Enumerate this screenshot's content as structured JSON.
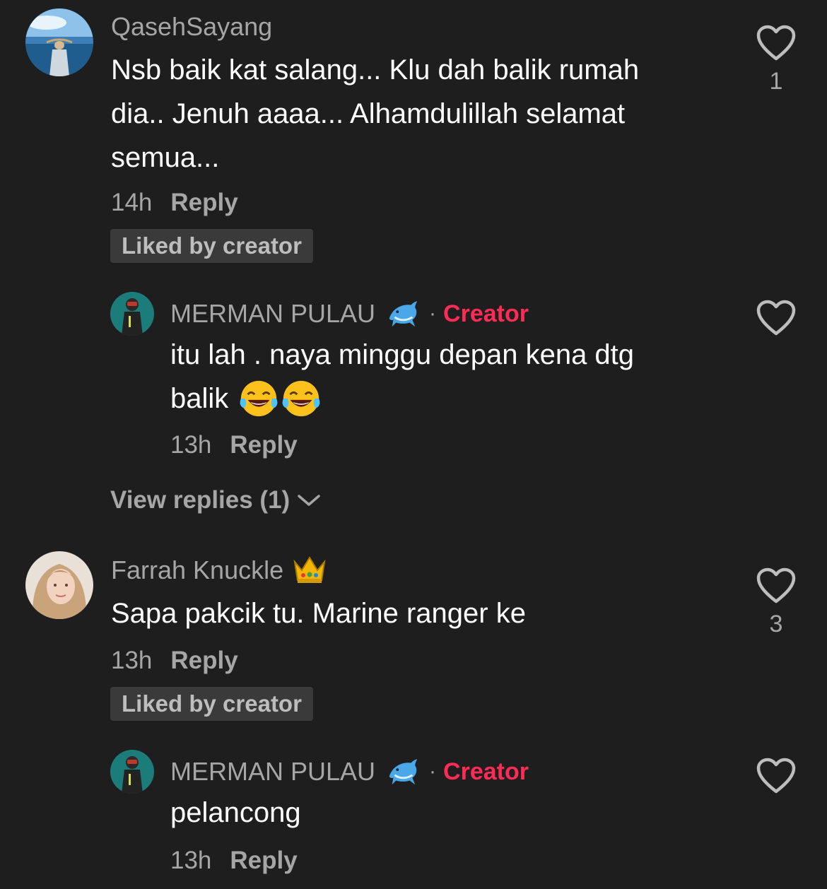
{
  "comments": [
    {
      "username": "QasehSayang",
      "text_lines": [
        "Nsb baik kat salang... Klu dah balik rumah",
        "dia.. Jenuh aaaa... Alhamdulillah selamat",
        "semua..."
      ],
      "time": "14h",
      "reply_label": "Reply",
      "badge": "Liked by creator",
      "likes": "1",
      "reply": {
        "username": "MERMAN PULAU",
        "username_emoji": "dolphin",
        "separator": "·",
        "role": "Creator",
        "text_lines": [
          "itu lah . naya minggu depan kena dtg",
          "balik"
        ],
        "text_emoji": "face-with-tears-of-joy x2",
        "time": "13h",
        "reply_label": "Reply"
      },
      "view_replies": "View replies (1)"
    },
    {
      "username": "Farrah Knuckle",
      "username_emoji": "crown",
      "text_lines": [
        "Sapa pakcik tu. Marine ranger ke"
      ],
      "time": "13h",
      "reply_label": "Reply",
      "badge": "Liked by creator",
      "likes": "3",
      "reply": {
        "username": "MERMAN PULAU",
        "username_emoji": "dolphin",
        "separator": "·",
        "role": "Creator",
        "text_lines": [
          "pelancong"
        ],
        "time": "13h",
        "reply_label": "Reply"
      }
    }
  ],
  "colors": {
    "background": "#1e1e1e",
    "creator": "#fe2c55",
    "muted": "#a6a6a6"
  },
  "icons": [
    "heart-outline-icon",
    "chevron-down-icon",
    "dolphin-emoji",
    "crown-emoji",
    "laughing-emoji"
  ]
}
